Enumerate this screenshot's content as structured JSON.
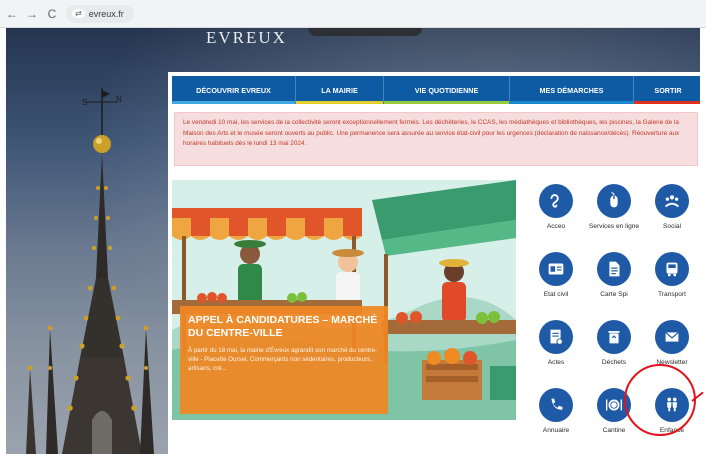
{
  "browser": {
    "back_icon": "arrow-left-icon",
    "forward_icon": "arrow-right-icon",
    "reload_icon": "reload-icon",
    "url": "evreux.fr"
  },
  "site": {
    "logo_text": "EVREUX"
  },
  "nav": {
    "items": [
      {
        "label": "DÉCOUVRIR EVREUX",
        "accent": "#3fa9e0"
      },
      {
        "label": "LA MAIRIE",
        "accent": "#e2cf2b"
      },
      {
        "label": "VIE QUOTIDIENNE",
        "accent": "#9acb3c"
      },
      {
        "label": "MES DÉMARCHES",
        "accent": "#1b8bd0"
      },
      {
        "label": "SORTIR",
        "accent": "#e0301e"
      }
    ]
  },
  "alert": {
    "text": "Le vendredi 10 mai, les services de la collectivité seront exceptionnellement fermés. Les déchèteries, le CCAS, les médiathèques et bibliothèques, les piscines, la Galerie de la Maison des Arts et le musée seront ouverts au public. Une permanence sera assurée au service état-civil pour les urgences (déclaration de naissance/décès). Réouverture aux horaires habituels dès le lundi 13 mai 2024."
  },
  "hero": {
    "title": "APPEL À CANDIDATURES – MARCHÉ DU CENTRE-VILLE",
    "description": "À partir du 18 mai, la mairie d'Évreux agrandit son marché du centre-ville - Placette Oursel. Commerçants non sédentaires, producteurs, artisans, cré..."
  },
  "quick_links": [
    {
      "label": "Acceo",
      "icon": "ear-icon"
    },
    {
      "label": "Services en ligne",
      "icon": "mouse-icon"
    },
    {
      "label": "Social",
      "icon": "community-icon"
    },
    {
      "label": "Etat civil",
      "icon": "id-card-icon"
    },
    {
      "label": "Carte Spi",
      "icon": "document-icon"
    },
    {
      "label": "Transport",
      "icon": "bus-icon"
    },
    {
      "label": "Actes",
      "icon": "certificate-icon"
    },
    {
      "label": "Déchets",
      "icon": "recycling-bin-icon"
    },
    {
      "label": "Newsletter",
      "icon": "mail-icon"
    },
    {
      "label": "Annuaire",
      "icon": "phone-icon"
    },
    {
      "label": "Cantine",
      "icon": "plate-icon"
    },
    {
      "label": "Enfance",
      "icon": "children-icon"
    }
  ],
  "highlight_color": "#e2111b"
}
